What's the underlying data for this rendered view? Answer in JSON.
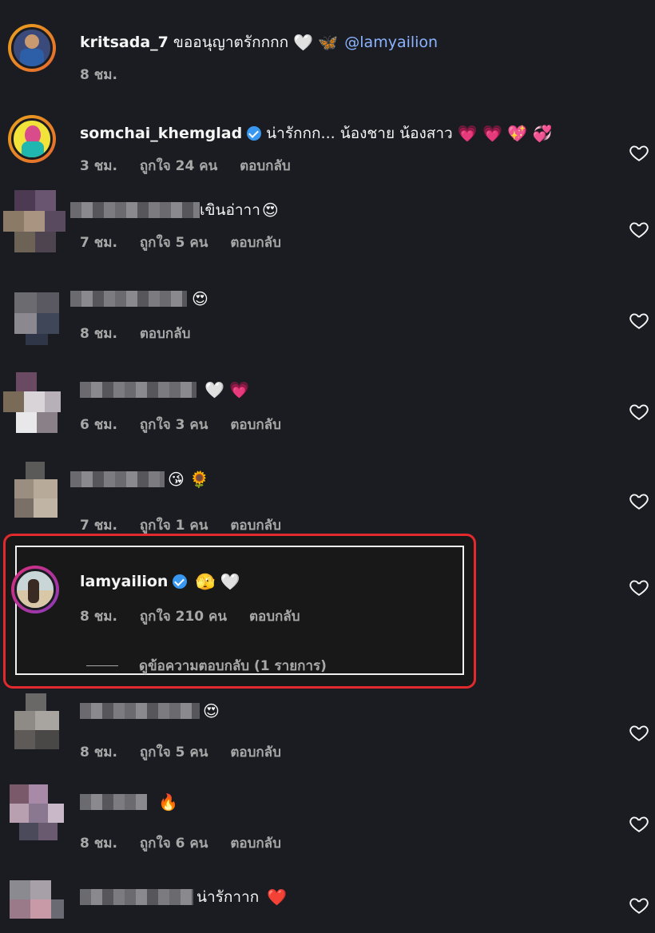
{
  "comments": [
    {
      "username": "kritsada_7",
      "text": "ขออนุญาตรักกกก",
      "emojis": "🤍 🦋",
      "mention": "@lamyailion",
      "time": "8 ชม."
    },
    {
      "username": "somchai_khemglad",
      "text": "น่ารักกก... น้องชาย น้องสาว",
      "emojis": "💗 💗 💖 💞",
      "time": "3 ชม.",
      "likes": "ถูกใจ 24 คน",
      "reply": "ตอบกลับ"
    },
    {
      "text": "เขินอ่าาา",
      "emojis": "😍",
      "time": "7 ชม.",
      "likes": "ถูกใจ 5 คน",
      "reply": "ตอบกลับ"
    },
    {
      "emojis": "😍",
      "time": "8 ชม.",
      "reply": "ตอบกลับ"
    },
    {
      "emojis": "🤍 💗",
      "time": "6 ชม.",
      "likes": "ถูกใจ 3 คน",
      "reply": "ตอบกลับ"
    },
    {
      "emojis": "😘 🌻",
      "time": "7 ชม.",
      "likes": "ถูกใจ 1 คน",
      "reply": "ตอบกลับ"
    },
    {
      "username": "lamyailion",
      "emojis": "🫣 🤍",
      "time": "8 ชม.",
      "likes": "ถูกใจ 210 คน",
      "reply": "ตอบกลับ",
      "view_replies": "ดูข้อความตอบกลับ (1 รายการ)"
    },
    {
      "emojis": "😍",
      "time": "8 ชม.",
      "likes": "ถูกใจ 5 คน",
      "reply": "ตอบกลับ"
    },
    {
      "emojis": "🔥",
      "time": "8 ชม.",
      "likes": "ถูกใจ 6 คน",
      "reply": "ตอบกลับ"
    },
    {
      "text": "น่ารักาาก",
      "emojis": "❤️"
    }
  ],
  "colors": {
    "highlight": "#e22a2e",
    "verified": "#3897f0",
    "mention": "#8ab4ff"
  }
}
